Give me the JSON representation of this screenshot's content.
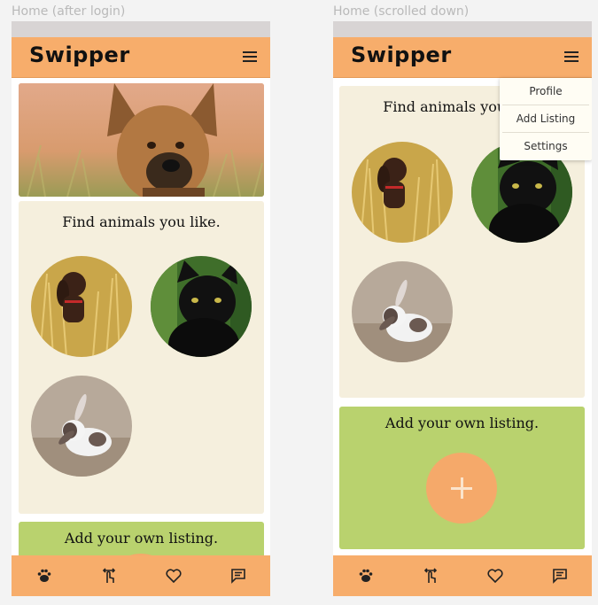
{
  "frames": [
    {
      "label": "Home (after login)",
      "app_name": "Swipper",
      "find_title": "Find animals you like.",
      "add_title": "Add your own listing."
    },
    {
      "label": "Home (scrolled down)",
      "app_name": "Swipper",
      "find_title": "Find animals you like.",
      "add_title": "Add your own listing.",
      "menu": [
        "Profile",
        "Add Listing",
        "Settings"
      ]
    }
  ],
  "nav_icons": [
    "paw-icon",
    "swipe-icon",
    "heart-icon",
    "chat-icon"
  ],
  "colors": {
    "header": "#f7ad6b",
    "cream_card": "#f5efdd",
    "green_card": "#b9d26e",
    "add_button": "#f5a96a"
  }
}
